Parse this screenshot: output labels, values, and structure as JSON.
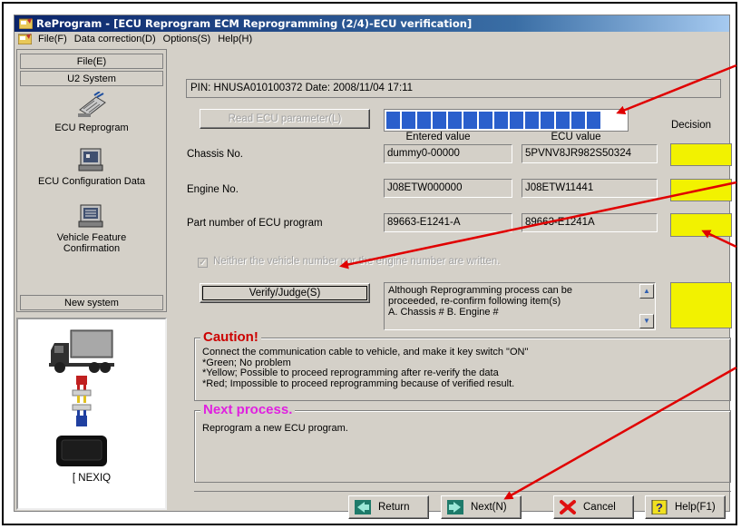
{
  "window": {
    "title": "ReProgram - [ECU Reprogram ECM Reprogramming (2/4)-ECU verification]"
  },
  "menubar": {
    "items": [
      {
        "label": "File(F)"
      },
      {
        "label": "Data correction(D)"
      },
      {
        "label": "Options(S)"
      },
      {
        "label": "Help(H)"
      }
    ]
  },
  "sidebar": {
    "file_header": "File(E)",
    "system_header": "U2 System",
    "items": [
      {
        "label": "ECU Reprogram",
        "icon": "ecu-reprogram-icon"
      },
      {
        "label": "ECU Configuration Data",
        "icon": "ecu-configuration-icon"
      },
      {
        "label_line1": "Vehicle Feature",
        "label_line2": "Confirmation",
        "icon": "vehicle-feature-icon"
      }
    ],
    "new_system": "New system",
    "device_label": "[ NEXIQ"
  },
  "main": {
    "pin_line": "PIN: HNUSA010100372  Date: 2008/11/04 17:11",
    "read_button": "Read ECU parameter(L)",
    "progress_segments": 14,
    "col_entered": "Entered value",
    "col_ecu": "ECU value",
    "col_decision": "Decision",
    "rows": [
      {
        "label": "Chassis No.",
        "entered": "dummy0-00000",
        "ecu": "5PVNV8JR982S50324"
      },
      {
        "label": "Engine No.",
        "entered": "J08ETW000000",
        "ecu": "J08ETW11441"
      },
      {
        "label": "Part number of ECU program",
        "entered": "89663-E1241-A",
        "ecu": "89663-E1241A"
      }
    ],
    "checkbox_label": "Neither the vehicle number nor the engine number are written.",
    "verify_button": "Verify/Judge(S)",
    "message_lines": [
      "Although Reprogramming process can be",
      "proceeded,  re-confirm following item(s)",
      "A. Chassis #      B. Engine #"
    ],
    "caution": {
      "title": "Caution!",
      "lines": [
        "Connect the communication cable to vehicle, and make it key switch \"ON\"",
        "  *Green; No problem",
        "  *Yellow; Possible to proceed reprogramming after re-verify the data",
        "  *Red; Impossible to proceed reprogramming because of verified result."
      ]
    },
    "next_process": {
      "title": "Next process.",
      "text": "Reprogram a new ECU program."
    }
  },
  "bottom_buttons": {
    "return": "Return",
    "next": "Next(N)",
    "cancel": "Cancel",
    "help": "Help(F1)"
  },
  "colors": {
    "decision_yellow": "#f2f200",
    "progress_blue": "#2a5fcc",
    "caution_red": "#cc0000",
    "next_magenta": "#e020e0",
    "annotation_arrow": "#e00000"
  }
}
